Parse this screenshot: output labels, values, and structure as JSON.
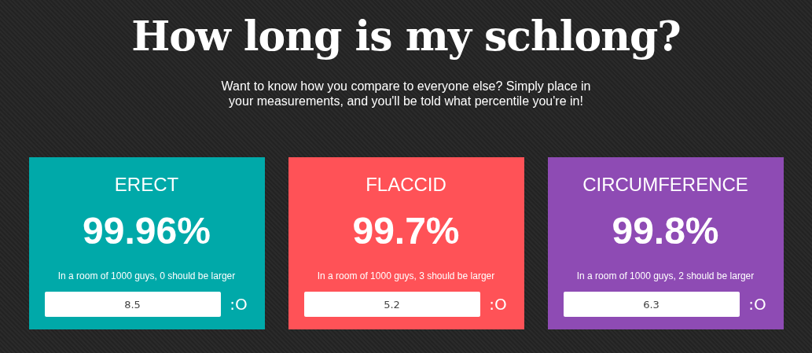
{
  "title": "How long is my schlong?",
  "intro": "Want to know how you compare to everyone else? Simply place in your measurements, and you'll be told what percentile you're in!",
  "cards": [
    {
      "heading": "ERECT",
      "percentile": "99.96%",
      "note": "In a room of 1000 guys, 0 should be larger",
      "value": "8.5",
      "reaction": ":O",
      "color": "#00a9a9"
    },
    {
      "heading": "FLACCID",
      "percentile": "99.7%",
      "note": "In a room of 1000 guys, 3 should be larger",
      "value": "5.2",
      "reaction": ":O",
      "color": "#ff5257"
    },
    {
      "heading": "CIRCUMFERENCE",
      "percentile": "99.8%",
      "note": "In a room of 1000 guys, 2 should be larger",
      "value": "6.3",
      "reaction": ":O",
      "color": "#8e4bb4"
    }
  ]
}
